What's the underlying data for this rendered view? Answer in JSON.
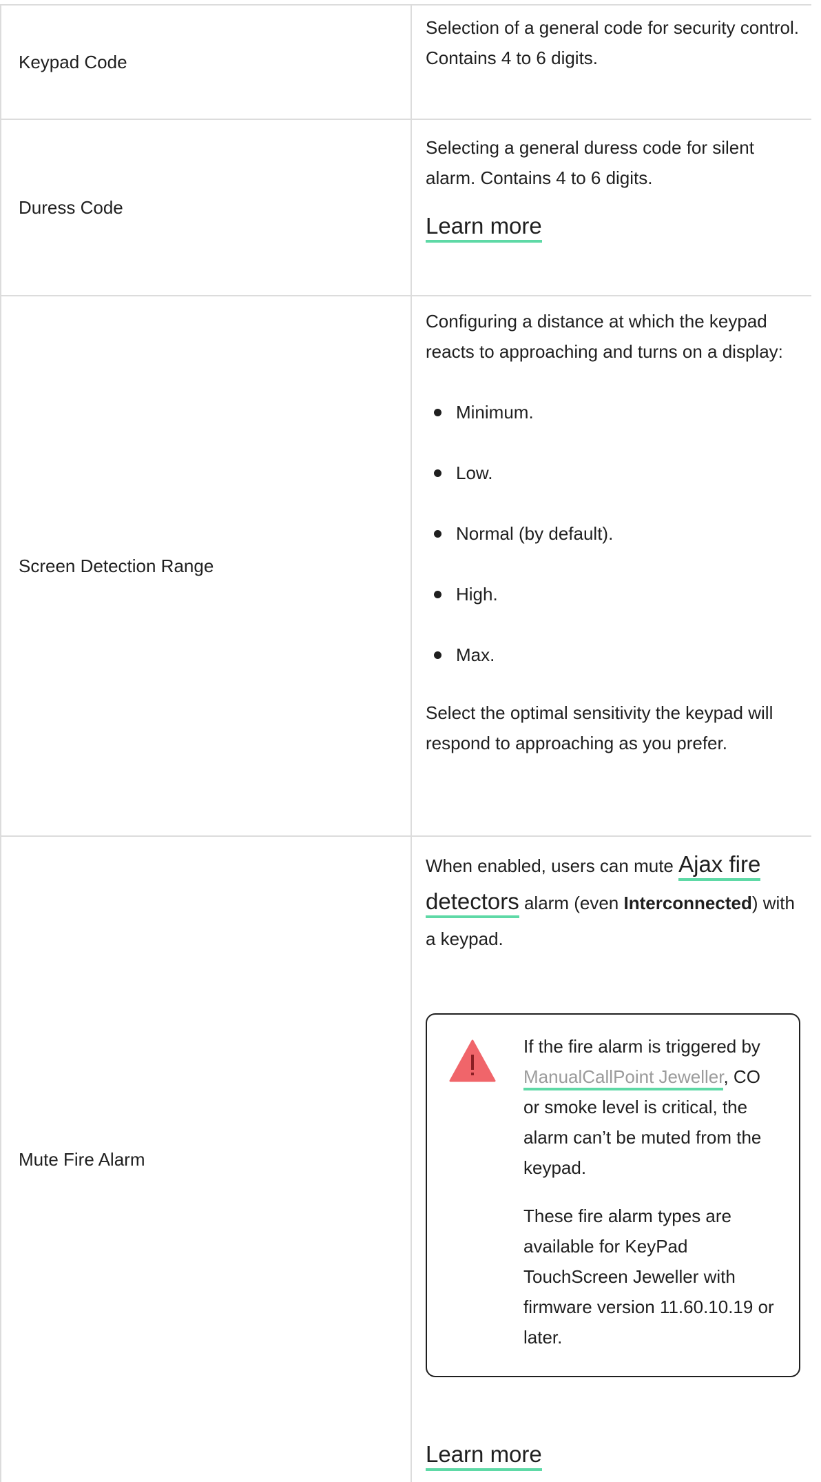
{
  "rows": [
    {
      "label": "Keypad Code",
      "desc": "Selection of a general code for security control. Contains 4 to 6 digits."
    },
    {
      "label": "Duress Code",
      "desc": "Selecting a general duress code for silent alarm. Contains 4 to 6 digits.",
      "link": "Learn more"
    },
    {
      "label": "Screen Detection Range",
      "intro": "Configuring a distance at which the keypad reacts to approaching and turns on a display:",
      "options": [
        "Minimum.",
        "Low.",
        "Normal (by default).",
        "High.",
        "Max."
      ],
      "outro": "Select the optimal sensitivity the keypad will respond to approaching as you prefer."
    },
    {
      "label": "Mute Fire Alarm",
      "text_before": "When enabled, users can mute ",
      "link_detectors": "Ajax fire detectors",
      "text_middle": " alarm (even ",
      "bold": "Interconnected",
      "text_after": ") with a keypad.",
      "warning": {
        "p1_before": "If the fire alarm is triggered by ",
        "p1_link": "ManualCallPoint Jeweller",
        "p1_after": ", CO or smoke level is critical, the alarm can’t be muted from the keypad.",
        "p2": "These fire alarm types are available for KeyPad TouchScreen Jeweller with firmware version 11.60.10.19 or later."
      },
      "link": "Learn more"
    }
  ],
  "colors": {
    "accent_underline": "#5ed9a6",
    "warning_icon": "#f0656a",
    "border": "#dcdcdc"
  }
}
